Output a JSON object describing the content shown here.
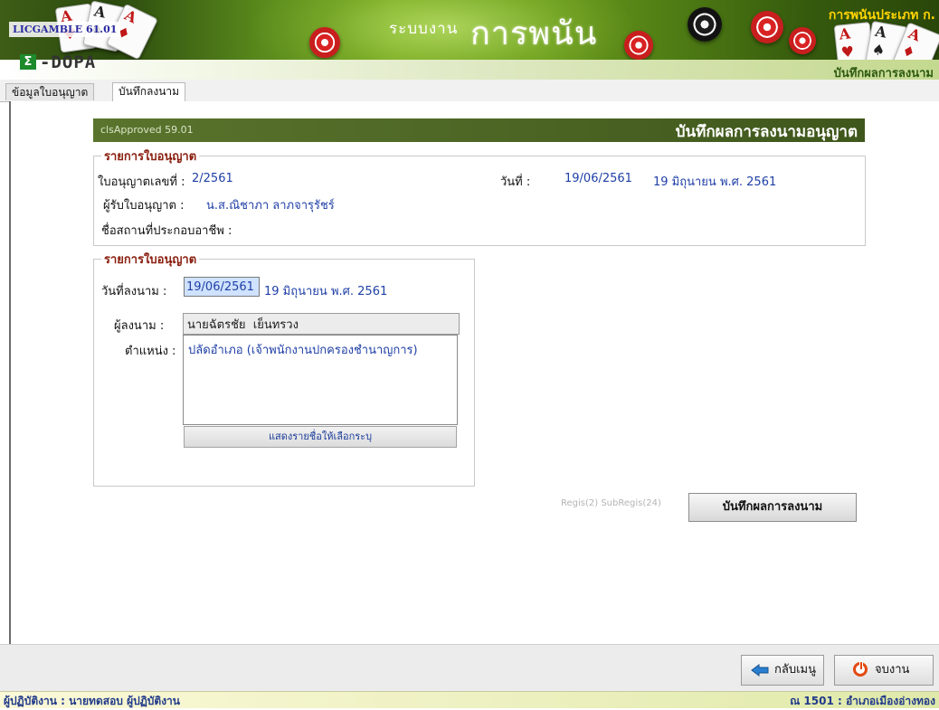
{
  "banner": {
    "app_code": "LICGAMBLE 61.01",
    "logo_sigma": "Σ",
    "logo_text": "-DOPA",
    "title_prefix": "ระบบงาน",
    "title_main": "การพนัน",
    "type_label": "การพนันประเภท ก.",
    "subtitle": "บันทึกผลการลงนาม"
  },
  "tabs": [
    {
      "label": "ข้อมูลใบอนุญาต",
      "active": false
    },
    {
      "label": "บันทึกลงนาม",
      "active": true
    }
  ],
  "form": {
    "code": "clsApproved 59.01",
    "title": "บันทึกผลการลงนามอนุญาต"
  },
  "license_info": {
    "legend": "รายการใบอนุญาต",
    "license_no_label": "ใบอนุญาตเลขที่ :",
    "license_no": "2/2561",
    "date_label": "วันที่ :",
    "date": "19/06/2561",
    "date_text": "19 มิถุนายน พ.ศ. 2561",
    "holder_label": "ผู้รับใบอนุญาต :",
    "holder": "น.ส.ณิชาภา  ลาภจารุรัชร์",
    "place_label": "ชื่อสถานที่ประกอบอาชีพ :"
  },
  "sign_info": {
    "legend": "รายการใบอนุญาต",
    "sign_date_label": "วันที่ลงนาม :",
    "sign_date": "19/06/2561",
    "sign_date_text": "19 มิถุนายน พ.ศ. 2561",
    "signer_label": "ผู้ลงนาม :",
    "signer": "นายฉัตรชัย  เย็นทรวง",
    "position_label": "ตำแหน่ง :",
    "position": "ปลัดอำเภอ (เจ้าพนักงานปกครองชำนาญการ)",
    "show_list_button": "แสดงรายชื่อให้เลือกระบุ"
  },
  "regis_info": "Regis(2)  SubRegis(24)",
  "save_button": "บันทึกผลการลงนาม",
  "bottom": {
    "back_button": "กลับเมนู",
    "exit_button": "จบงาน"
  },
  "status": {
    "left": "ผู้ปฏิบัติงาน : นายทดสอบ ผู้ปฏิบัติงาน",
    "right": "ณ 1501 : อำเภอเมืองอ่างทอง"
  },
  "colors": {
    "banner_green": "#4f7c14",
    "header_green": "#4c6524",
    "legend_red": "#8a2010",
    "value_blue": "#1f3fa6",
    "type_label_yellow": "#ffd400"
  }
}
